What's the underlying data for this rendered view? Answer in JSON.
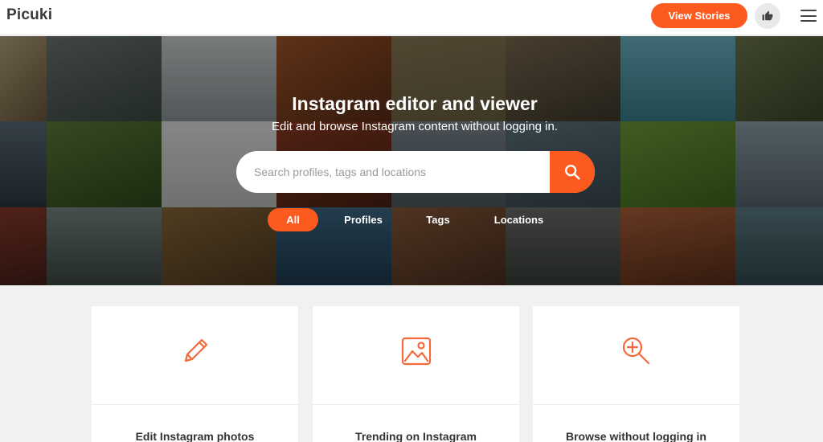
{
  "header": {
    "logo": "Picuki",
    "view_stories_label": "View Stories",
    "like_icon": "thumbs-up-icon",
    "menu_icon": "hamburger-menu-icon"
  },
  "hero": {
    "title": "Instagram editor and viewer",
    "subtitle": "Edit and browse Instagram content without logging in.",
    "search": {
      "placeholder": "Search profiles, tags and locations",
      "value": "",
      "button_icon": "search-icon"
    },
    "filters": [
      {
        "label": "All",
        "active": true
      },
      {
        "label": "Profiles",
        "active": false
      },
      {
        "label": "Tags",
        "active": false
      },
      {
        "label": "Locations",
        "active": false
      }
    ]
  },
  "features": [
    {
      "icon": "pencil-icon",
      "label": "Edit Instagram photos"
    },
    {
      "icon": "image-icon",
      "label": "Trending on Instagram"
    },
    {
      "icon": "zoom-in-icon",
      "label": "Browse without logging in"
    }
  ],
  "colors": {
    "accent": "#fc5a1e",
    "header_bg": "#ffffff",
    "page_bg": "#f1f1f1",
    "card_bg": "#ffffff"
  }
}
